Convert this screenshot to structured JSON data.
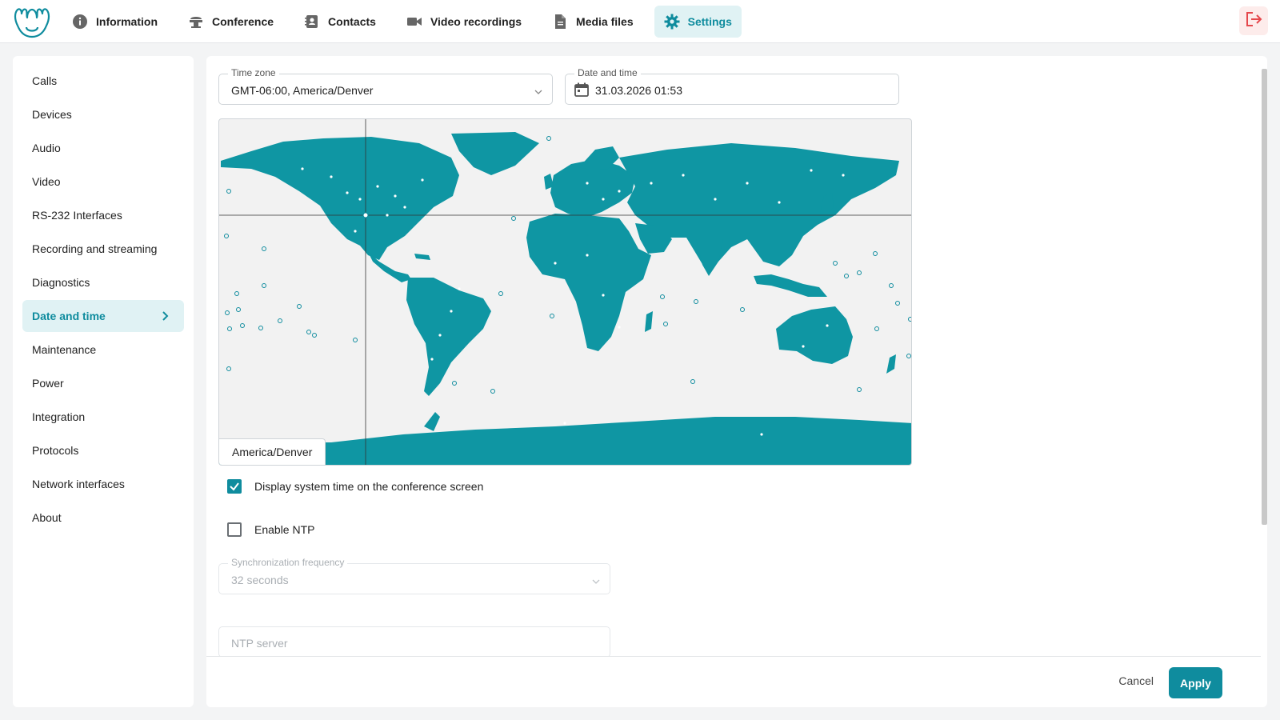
{
  "nav": {
    "items": [
      {
        "label": "Information",
        "icon": "info-icon"
      },
      {
        "label": "Conference",
        "icon": "conference-icon"
      },
      {
        "label": "Contacts",
        "icon": "contacts-icon"
      },
      {
        "label": "Video recordings",
        "icon": "video-camera-icon"
      },
      {
        "label": "Media files",
        "icon": "file-icon"
      },
      {
        "label": "Settings",
        "icon": "gear-icon"
      }
    ],
    "active": "Settings"
  },
  "sidebar": {
    "items": [
      {
        "label": "Calls"
      },
      {
        "label": "Devices"
      },
      {
        "label": "Audio"
      },
      {
        "label": "Video"
      },
      {
        "label": "RS-232 Interfaces"
      },
      {
        "label": "Recording and streaming"
      },
      {
        "label": "Diagnostics"
      },
      {
        "label": "Date and time"
      },
      {
        "label": "Maintenance"
      },
      {
        "label": "Power"
      },
      {
        "label": "Integration"
      },
      {
        "label": "Protocols"
      },
      {
        "label": "Network interfaces"
      },
      {
        "label": "About"
      }
    ],
    "active": "Date and time"
  },
  "form": {
    "timezone": {
      "label": "Time zone",
      "value": "GMT-06:00, America/Denver"
    },
    "datetime": {
      "label": "Date and time",
      "value": "31.03.2026 01:53"
    },
    "map_label": "America/Denver",
    "display_time": {
      "label": "Display system time on the conference screen",
      "checked": true
    },
    "ntp": {
      "label": "Enable NTP",
      "checked": false
    },
    "sync_freq": {
      "label": "Synchronization frequency",
      "value": "32 seconds"
    },
    "ntp_server": {
      "label": "NTP server"
    }
  },
  "footer": {
    "cancel": "Cancel",
    "apply": "Apply"
  },
  "colors": {
    "accent": "#0f8c9e",
    "accent_light": "#e0f2f4",
    "logout_bg": "#fdeceb",
    "logout_icon": "#e5484d"
  }
}
